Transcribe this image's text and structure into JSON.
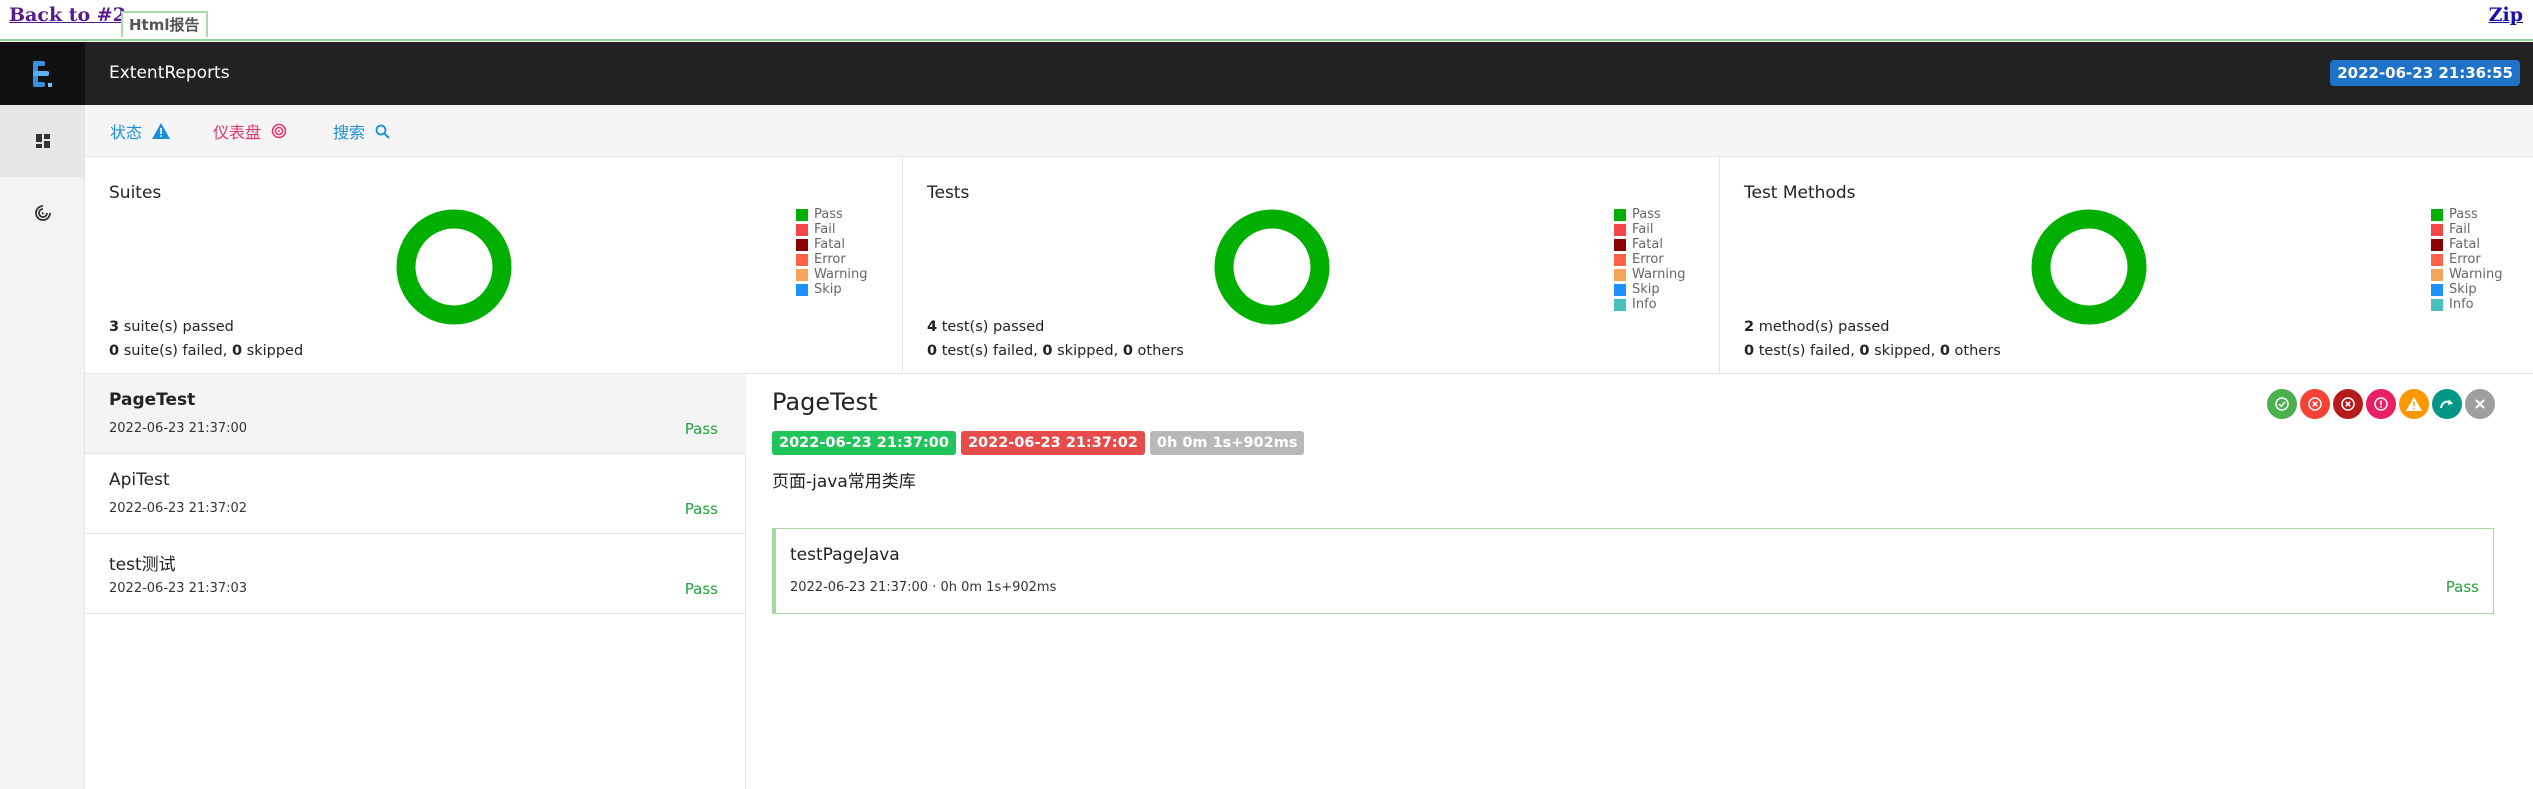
{
  "top": {
    "back_link": "Back to #2",
    "html_tab": "Html报告",
    "zip_link": "Zip"
  },
  "header": {
    "brand": "ExtentReports",
    "datetime": "2022-06-23 21:36:55"
  },
  "nav": {
    "status": "状态",
    "dashboard": "仪表盘",
    "search": "搜索"
  },
  "summary": [
    {
      "title": "Suites",
      "line1_count": "3",
      "line1_text": " suite(s) passed",
      "line2": {
        "a": "0",
        "a_text": " suite(s) failed, ",
        "b": "0",
        "b_text": " skipped",
        "c": "",
        "c_text": ""
      },
      "legend": [
        "Pass",
        "Fail",
        "Fatal",
        "Error",
        "Warning",
        "Skip"
      ]
    },
    {
      "title": "Tests",
      "line1_count": "4",
      "line1_text": " test(s) passed",
      "line2": {
        "a": "0",
        "a_text": " test(s) failed, ",
        "b": "0",
        "b_text": " skipped, ",
        "c": "0",
        "c_text": " others"
      },
      "legend": [
        "Pass",
        "Fail",
        "Fatal",
        "Error",
        "Warning",
        "Skip",
        "Info"
      ]
    },
    {
      "title": "Test Methods",
      "line1_count": "2",
      "line1_text": " method(s) passed",
      "line2": {
        "a": "0",
        "a_text": " test(s) failed, ",
        "b": "0",
        "b_text": " skipped, ",
        "c": "0",
        "c_text": " others"
      },
      "legend": [
        "Pass",
        "Fail",
        "Fatal",
        "Error",
        "Warning",
        "Skip",
        "Info"
      ]
    }
  ],
  "legend_colors": {
    "Pass": "#00af00",
    "Fail": "#f7464a",
    "Fatal": "#8b0000",
    "Error": "#ff6347",
    "Warning": "#f2a45a",
    "Skip": "#1e90ff",
    "Info": "#46bfbd"
  },
  "pass_color": "#00af00",
  "tests": [
    {
      "name": "PageTest",
      "time": "2022-06-23 21:37:00",
      "status": "Pass"
    },
    {
      "name": "ApiTest",
      "time": "2022-06-23 21:37:02",
      "status": "Pass"
    },
    {
      "name": "test测试",
      "time": "2022-06-23 21:37:03",
      "status": "Pass"
    }
  ],
  "detail": {
    "title": "PageTest",
    "start": "2022-06-23 21:37:00",
    "end": "2022-06-23 21:37:02",
    "duration": "0h 0m 1s+902ms",
    "description": "页面-java常用类库",
    "method": {
      "name": "testPageJava",
      "meta": "2022-06-23 21:37:00 · 0h 0m 1s+902ms",
      "status": "Pass"
    }
  }
}
